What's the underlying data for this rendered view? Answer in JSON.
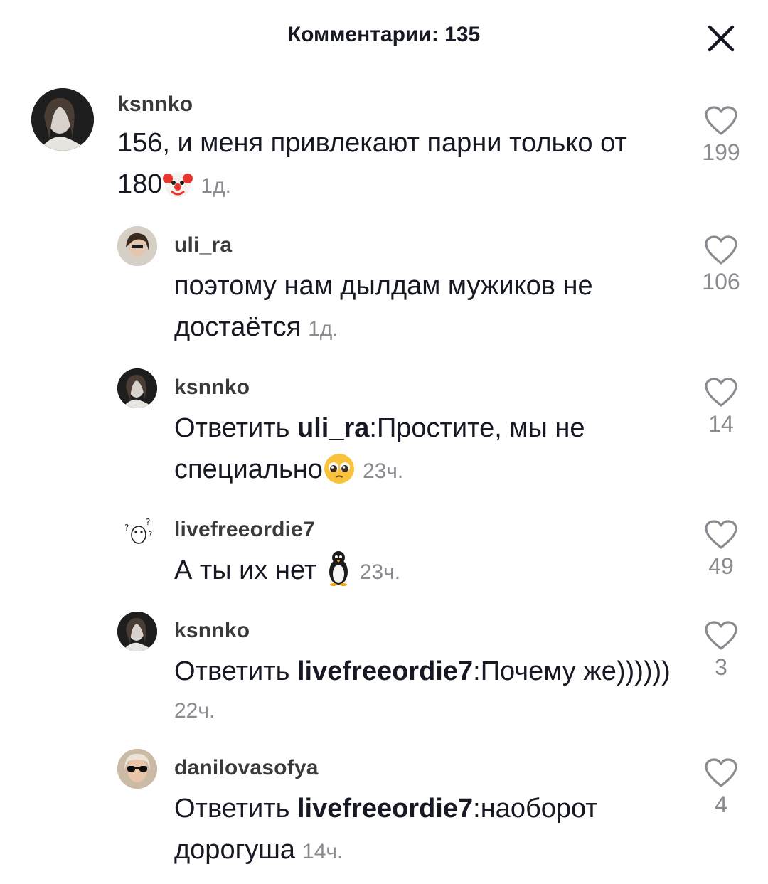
{
  "header": {
    "title": "Комментарии: 135"
  },
  "comments": [
    {
      "username": "ksnnko",
      "text": "156, и меня привлекают парни только от 180",
      "emoji": "clown-face",
      "time": "1д.",
      "likes": "199"
    },
    {
      "username": "uli_ra",
      "text": "поэтому нам дылдам мужиков не достаётся",
      "time": "1д.",
      "likes": "106"
    },
    {
      "username": "ksnnko",
      "reply_prefix": "Ответить ",
      "reply_to": "uli_ra",
      "text": ":Простите, мы не специально",
      "emoji": "pleading-face",
      "time": "23ч.",
      "likes": "14"
    },
    {
      "username": "livefreeordie7",
      "text": "А ты их нет ",
      "emoji": "penguin",
      "time": "23ч.",
      "likes": "49"
    },
    {
      "username": "ksnnko",
      "reply_prefix": "Ответить ",
      "reply_to": "livefreeordie7",
      "text": ":Почему же))))))",
      "time": "22ч.",
      "likes": "3"
    },
    {
      "username": "danilovasofya",
      "reply_prefix": "Ответить ",
      "reply_to": "livefreeordie7",
      "text": ":наоборот дорогуша",
      "time": "14ч.",
      "likes": "4"
    }
  ]
}
